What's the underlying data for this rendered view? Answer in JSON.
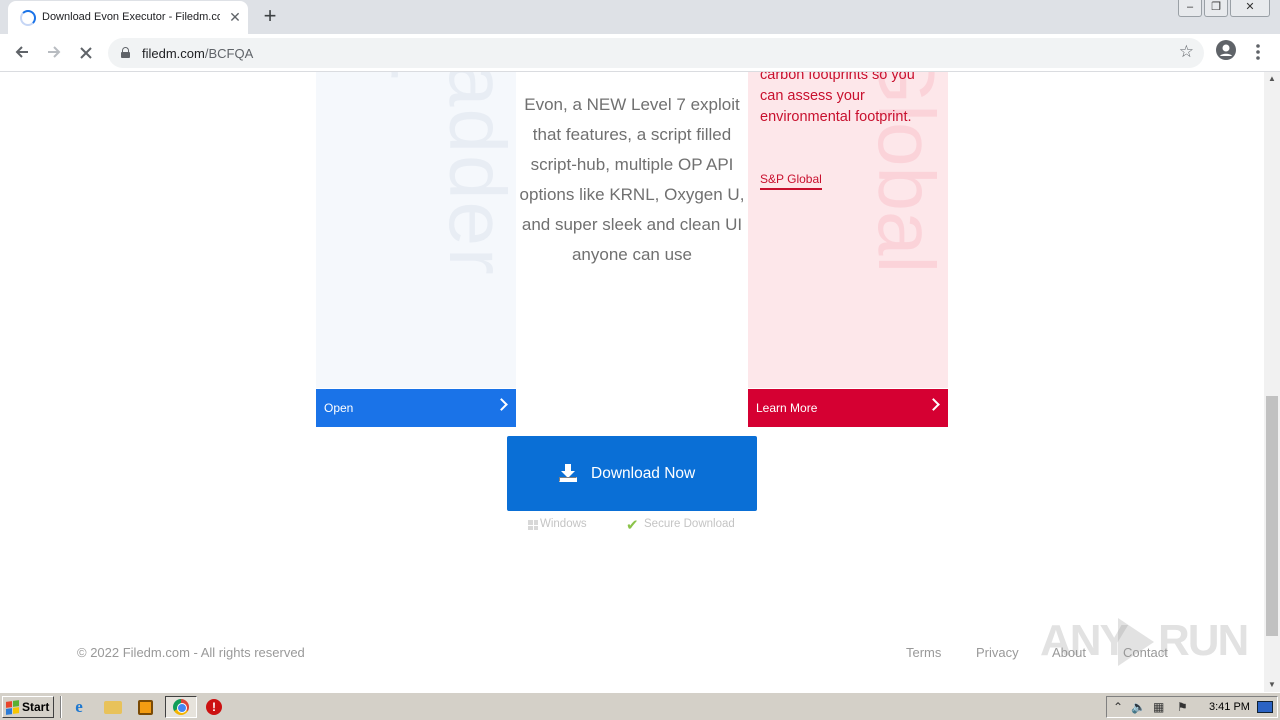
{
  "browser": {
    "tab_title": "Download Evon Executor - Filedm.com",
    "tab_close": "✕",
    "new_tab": "+",
    "url_domain": "filedm.com",
    "url_path": "/BCFQA",
    "window_controls": {
      "minimize": "‒",
      "restore": "❐",
      "close": "✕"
    }
  },
  "ads": {
    "left": {
      "bg_text": "adder",
      "bg_text2": "r",
      "button_label": "Open"
    },
    "right": {
      "text": "carbon footprints so you can assess your environmental footprint.",
      "brand": "S&P Global",
      "bg_text": "Global",
      "button_label": "Learn More"
    }
  },
  "description": "Evon, a NEW Level 7 exploit that features, a script filled script-hub, multiple OP API options like KRNL, Oxygen U, and super sleek and clean UI anyone can use",
  "download": {
    "label": "Download Now",
    "platform": "Windows",
    "secure": "Secure Download"
  },
  "footer": {
    "copyright": "© 2022 Filedm.com - All rights reserved",
    "links": [
      "Terms",
      "Privacy",
      "About",
      "Contact"
    ]
  },
  "watermark": {
    "left": "ANY",
    "right": "RUN"
  },
  "taskbar": {
    "start_label": "Start",
    "clock": "3:41 PM"
  },
  "colors": {
    "download_blue": "#0a6fd6",
    "ad_left_blue": "#1a73e8",
    "ad_right_red": "#d50032",
    "ad_right_bg": "#fde7ea"
  }
}
